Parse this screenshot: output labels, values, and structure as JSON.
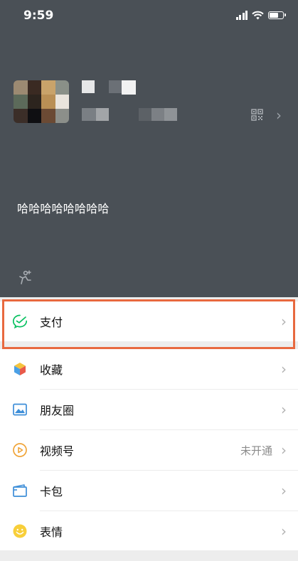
{
  "status_bar": {
    "time": "9:59"
  },
  "profile": {
    "status_text": "哈哈哈哈哈哈哈哈"
  },
  "menu": {
    "pay": {
      "label": "支付"
    },
    "items": [
      {
        "label": "收藏",
        "icon": "favorites-icon"
      },
      {
        "label": "朋友圈",
        "icon": "moments-icon"
      },
      {
        "label": "视频号",
        "icon": "channels-icon",
        "value": "未开通"
      },
      {
        "label": "卡包",
        "icon": "cards-icon"
      },
      {
        "label": "表情",
        "icon": "stickers-icon"
      }
    ]
  },
  "colors": {
    "header_bg": "#4a5056",
    "highlight": "#e8693f",
    "pay_green": "#07c160"
  }
}
